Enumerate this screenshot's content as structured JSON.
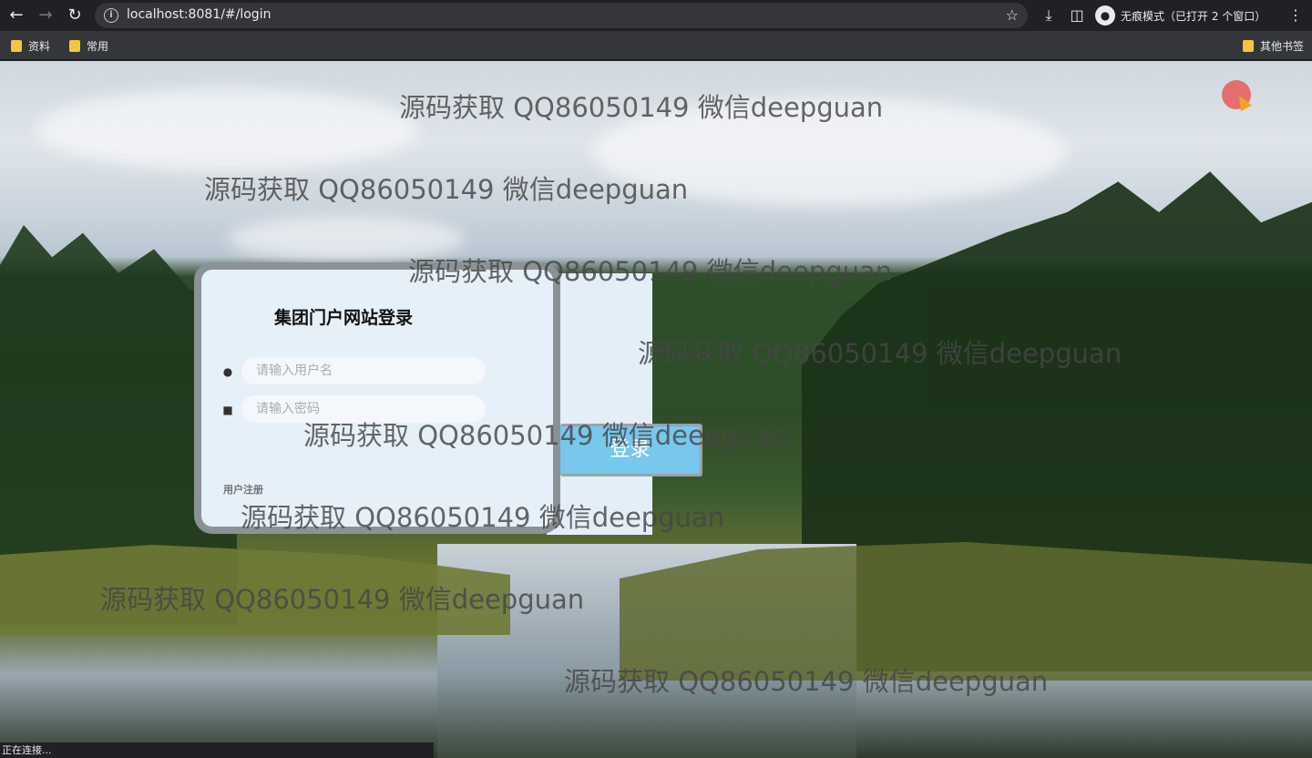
{
  "browser": {
    "url": "localhost:8081/#/login",
    "incognito_label": "无痕模式（已打开 2 个窗口）",
    "bookmarks": [
      {
        "label": "资料"
      },
      {
        "label": "常用"
      }
    ],
    "other_bookmarks_label": "其他书签",
    "status_text": "正在连接..."
  },
  "login": {
    "title": "集团门户网站登录",
    "username_placeholder": "请输入用户名",
    "password_placeholder": "请输入密码",
    "login_button": "登录",
    "register_link": "用户注册"
  },
  "watermark": {
    "text": "源码获取 QQ86050149 微信deepguan"
  },
  "colors": {
    "login_button": "#78c7ec",
    "card_background": "#e6f0f9",
    "card_border": "#8b9296"
  },
  "icons": {
    "back": "arrow-left-icon",
    "forward": "arrow-right-icon",
    "reload": "reload-icon",
    "info": "info-icon",
    "bookmark_star": "star-icon",
    "download": "download-icon",
    "side_panel": "side-panel-icon",
    "incognito": "incognito-icon",
    "menu": "more-vert-icon",
    "user": "user-icon",
    "lock": "lock-icon"
  }
}
